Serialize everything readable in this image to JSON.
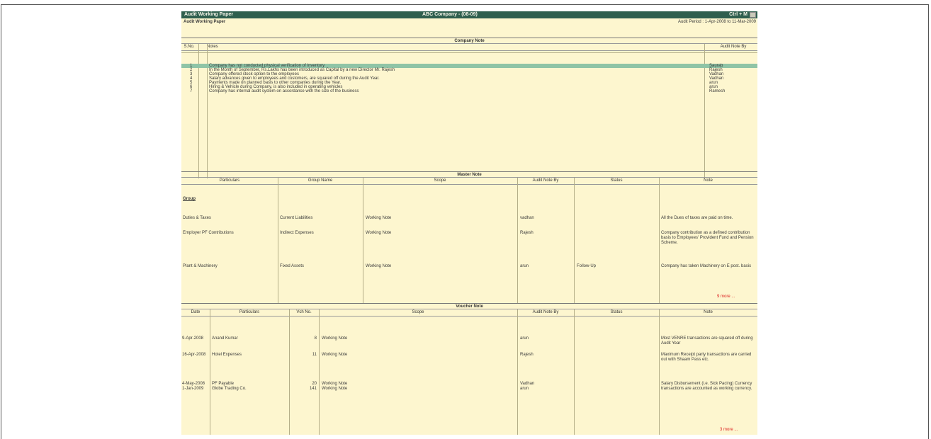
{
  "window": {
    "left_title": "Audit Working Paper",
    "center_title": "ABC Company - (08-09)",
    "right_title": "Ctrl + M"
  },
  "subheader": {
    "left": "Audit Working Paper",
    "right": "Audit Period : 1-Apr-2008 to 11-Mar-2009"
  },
  "company_note": {
    "title": "Company Note",
    "col_sno": "S.No.",
    "col_notes": "Notes",
    "col_audit_note_by": "Audit Note By",
    "rows": [
      {
        "sno": "1",
        "text": "Company has not conducted physical verification of Inventory",
        "by": "Saurab"
      },
      {
        "sno": "2",
        "text": "In the Month of September, Rs.Lakhs has been introduced as Capital by a new Director Mr. Rajesh",
        "by": "Rajesh"
      },
      {
        "sno": "3",
        "text": "Company offered stock option to the employees",
        "by": "Vadhan"
      },
      {
        "sno": "4",
        "text": "Salary advances given to employees and customers, are squared off during the Audit Year.",
        "by": "Vadhan"
      },
      {
        "sno": "5",
        "text": "Payments made on planned basis to other companies during the Year.",
        "by": "arun"
      },
      {
        "sno": "6",
        "text": "Hiring & Vehicle during Company, is also included in operating vehicles",
        "by": "arun"
      },
      {
        "sno": "7",
        "text": "Company has internal audit system on accordance with the size of the business",
        "by": "Ramesh"
      }
    ]
  },
  "master_note": {
    "title": "Master Note",
    "col_particulars": "Particulars",
    "col_group": "Group Name",
    "col_scope": "Scope",
    "col_by": "Audit Note By",
    "col_status": "Status",
    "col_note": "Note",
    "group_heading": "Group",
    "rows": [
      {
        "particulars": "Duties & Taxes",
        "group": "Current Liabilities",
        "scope": "Working Note",
        "by": "vadhan",
        "status": "",
        "note": "All the Dues of taxes are paid on time."
      },
      {
        "particulars": "Employer PF Contributions",
        "group": "Indirect Expenses",
        "scope": "Working Note",
        "by": "Rajesh",
        "status": "",
        "note": "Company contribution as a defined contribution basis to Employees' Provident Fund and Pension Scheme."
      },
      {
        "particulars": "Plant & Machinery",
        "group": "Fixed Assets",
        "scope": "Working Note",
        "by": "arun",
        "status": "Follow-Up",
        "note": "Company has taken Machinery on E post. basis"
      }
    ],
    "more": "9 more ..."
  },
  "voucher_note": {
    "title": "Voucher Note",
    "col_date": "Date",
    "col_particulars": "Particulars",
    "col_vchno": "Vch No.",
    "col_scope": "Scope",
    "col_by": "Audit Note By",
    "col_status": "Status",
    "col_note": "Note",
    "rows": [
      {
        "date": "9-Apr-2008",
        "particulars": "Anand Kumar",
        "vchno": "8",
        "scope": "Working Note",
        "by": "arun",
        "status": "",
        "note": "Most VENRE transactions are squared off during Audit Year"
      },
      {
        "date": "16-Apr-2008",
        "particulars": "Hotel Expenses",
        "vchno": "11",
        "scope": "Working Note",
        "by": "Rajesh",
        "status": "",
        "note": "Maximum Receipt party transactions are carried out with Shaam Pass etc."
      },
      {
        "date": "4-May-2008",
        "particulars": "PF Payable",
        "vchno": "20",
        "scope": "Working Note",
        "by": "Vadhan",
        "status": "",
        "note": "Salary Disbursement (i.e. Sick Pacing) Currency transactions are accounted as working currency."
      },
      {
        "date": "1-Jan-2009",
        "particulars": "Globe Trading Co.",
        "vchno": "141",
        "scope": "Working Note",
        "by": "arun",
        "status": "",
        "note": ""
      }
    ],
    "more": "3 more ..."
  }
}
